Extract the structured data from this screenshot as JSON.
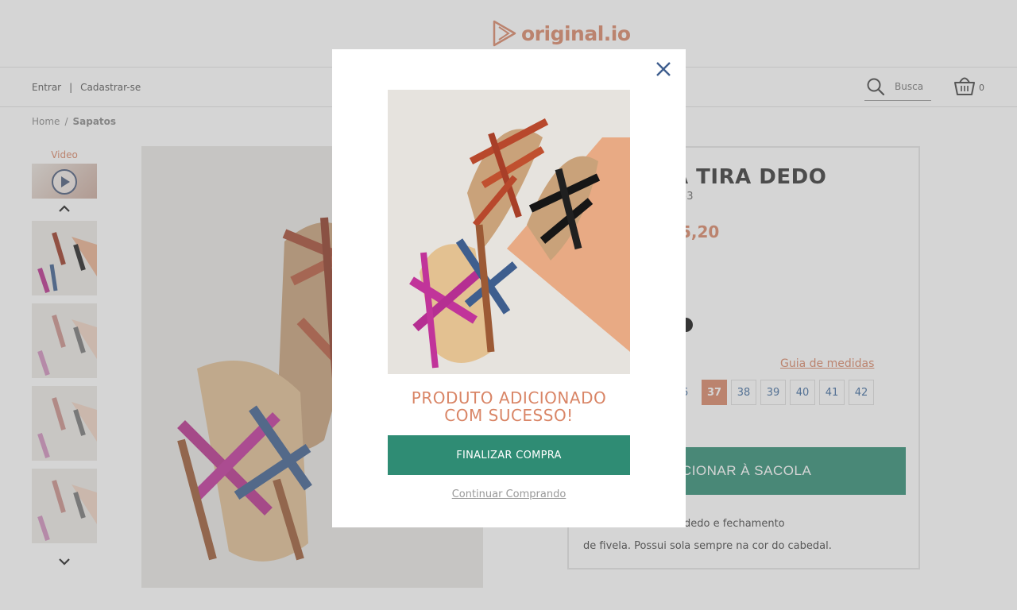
{
  "header": {
    "logo_text": "original.io"
  },
  "nav": {
    "login": "Entrar",
    "separator": "|",
    "register": "Cadastrar-se",
    "search_placeholder": "Busca",
    "cart_count": "0"
  },
  "breadcrumb": {
    "home": "Home",
    "sep": "/",
    "current": "Sapatos"
  },
  "gallery": {
    "video_label": "Video"
  },
  "product": {
    "title_visible": "A TIRA DEDO",
    "code_visible": "53",
    "price_visible": "5,20",
    "size_guide": "Guia de medidas",
    "sizes": [
      "6",
      "37",
      "38",
      "39",
      "40",
      "41",
      "42"
    ],
    "selected_size": "37",
    "add_to_bag_visible": "ICIONAR À SACOLA",
    "description_visible": "do soft com tira no dedo e fechamento\nde fivela. Possui sola sempre na cor do cabedal."
  },
  "modal": {
    "title_line1": "PRODUTO ADICIONADO",
    "title_line2": "COM SUCESSO!",
    "finish_label": "FINALIZAR COMPRA",
    "continue_label": "Continuar Comprando"
  },
  "colors": {
    "accent": "#d98566",
    "primary_button": "#2f8c74",
    "link_blue": "#3e6a9e",
    "overlay": "rgba(128,128,128,0.33)"
  }
}
